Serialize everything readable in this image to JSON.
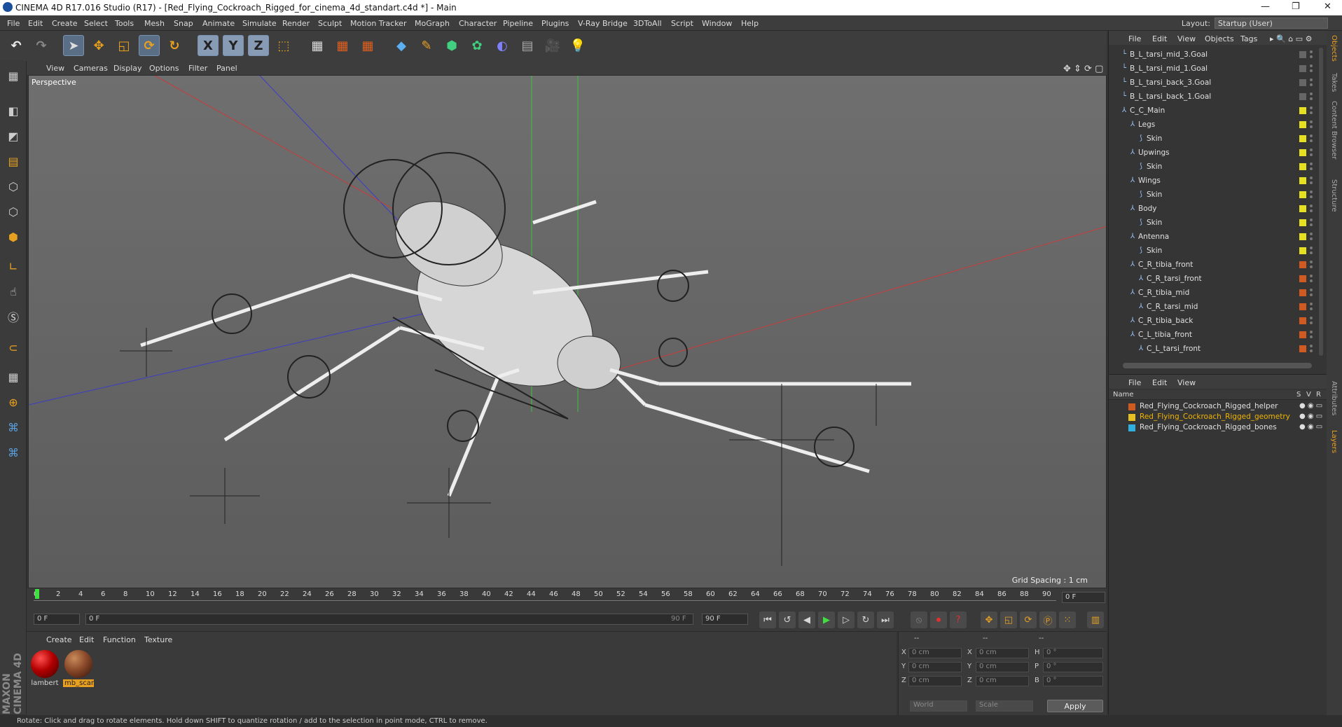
{
  "window": {
    "title": "CINEMA 4D R17.016 Studio (R17) - [Red_Flying_Cockroach_Rigged_for_cinema_4d_standart.c4d *] - Main"
  },
  "menu": [
    "File",
    "Edit",
    "Create",
    "Select",
    "Tools",
    "Mesh",
    "Snap",
    "Animate",
    "Simulate",
    "Render",
    "Sculpt",
    "Motion Tracker",
    "MoGraph",
    "Character",
    "Pipeline",
    "Plugins",
    "V-Ray Bridge",
    "3DToAll",
    "Script",
    "Window",
    "Help"
  ],
  "layout": {
    "label": "Layout:",
    "value": "Startup (User)"
  },
  "toolbar": {
    "undo": "↶",
    "redo": "↷",
    "x": "X",
    "y": "Y",
    "z": "Z"
  },
  "viewport": {
    "menu": [
      "View",
      "Cameras",
      "Display",
      "Options",
      "Filter",
      "Panel"
    ],
    "label": "Perspective",
    "grid": "Grid Spacing : 1 cm"
  },
  "timeline": {
    "ticks": [
      "0",
      "2",
      "4",
      "6",
      "8",
      "10",
      "12",
      "14",
      "16",
      "18",
      "20",
      "22",
      "24",
      "26",
      "28",
      "30",
      "32",
      "34",
      "36",
      "38",
      "40",
      "42",
      "44",
      "46",
      "48",
      "50",
      "52",
      "54",
      "56",
      "58",
      "60",
      "62",
      "64",
      "66",
      "68",
      "70",
      "72",
      "74",
      "76",
      "78",
      "80",
      "82",
      "84",
      "86",
      "88",
      "90"
    ],
    "end": "0 F"
  },
  "transport": {
    "start": "0 F",
    "current": "0 F",
    "end_inner": "90 F",
    "end": "90 F"
  },
  "materials": {
    "menu": [
      "Create",
      "Edit",
      "Function",
      "Texture"
    ],
    "items": [
      {
        "name": "lambert",
        "color": "#b30000"
      },
      {
        "name": "mb_scar",
        "color": "#8a4a2a"
      }
    ]
  },
  "coords": {
    "headers": [
      "--",
      "--",
      "--"
    ],
    "rows": [
      {
        "a": "X",
        "av": "0 cm",
        "b": "X",
        "bv": "0 cm",
        "c": "H",
        "cv": "0 °"
      },
      {
        "a": "Y",
        "av": "0 cm",
        "b": "Y",
        "bv": "0 cm",
        "c": "P",
        "cv": "0 °"
      },
      {
        "a": "Z",
        "av": "0 cm",
        "b": "Z",
        "bv": "0 cm",
        "c": "B",
        "cv": "0 °"
      }
    ],
    "world": "World",
    "scale": "Scale",
    "apply": "Apply"
  },
  "status": "Rotate: Click and drag to rotate elements. Hold down SHIFT to quantize rotation / add to the selection in point mode, CTRL to remove.",
  "objects": {
    "menu": [
      "File",
      "Edit",
      "View",
      "Objects",
      "Tags"
    ],
    "rows": [
      {
        "name": "B_L_tarsi_mid_3.Goal",
        "indent": 0,
        "tag": "#666"
      },
      {
        "name": "B_L_tarsi_mid_1.Goal",
        "indent": 0,
        "tag": "#666"
      },
      {
        "name": "B_L_tarsi_back_3.Goal",
        "indent": 0,
        "tag": "#666"
      },
      {
        "name": "B_L_tarsi_back_1.Goal",
        "indent": 0,
        "tag": "#666"
      },
      {
        "name": "C_C_Main",
        "indent": 0,
        "tag": "#e6e020"
      },
      {
        "name": "Legs",
        "indent": 1,
        "tag": "#e6e020"
      },
      {
        "name": "Skin",
        "indent": 2,
        "tag": "#e6e020"
      },
      {
        "name": "Upwings",
        "indent": 1,
        "tag": "#e6e020"
      },
      {
        "name": "Skin",
        "indent": 2,
        "tag": "#e6e020"
      },
      {
        "name": "Wings",
        "indent": 1,
        "tag": "#e6e020"
      },
      {
        "name": "Skin",
        "indent": 2,
        "tag": "#e6e020"
      },
      {
        "name": "Body",
        "indent": 1,
        "tag": "#e6e020"
      },
      {
        "name": "Skin",
        "indent": 2,
        "tag": "#e6e020"
      },
      {
        "name": "Antenna",
        "indent": 1,
        "tag": "#e6e020"
      },
      {
        "name": "Skin",
        "indent": 2,
        "tag": "#e6e020"
      },
      {
        "name": "C_R_tibia_front",
        "indent": 1,
        "tag": "#d05a20"
      },
      {
        "name": "C_R_tarsi_front",
        "indent": 2,
        "tag": "#d05a20"
      },
      {
        "name": "C_R_tibia_mid",
        "indent": 1,
        "tag": "#d05a20"
      },
      {
        "name": "C_R_tarsi_mid",
        "indent": 2,
        "tag": "#d05a20"
      },
      {
        "name": "C_R_tibia_back",
        "indent": 1,
        "tag": "#d05a20"
      },
      {
        "name": "C_L_tibia_front",
        "indent": 1,
        "tag": "#d05a20"
      },
      {
        "name": "C_L_tarsi_front",
        "indent": 2,
        "tag": "#d05a20"
      }
    ]
  },
  "layers": {
    "menu": [
      "File",
      "Edit",
      "View"
    ],
    "col_name": "Name",
    "cols": [
      "S",
      "V",
      "R"
    ],
    "rows": [
      {
        "name": "Red_Flying_Cockroach_Rigged_helper",
        "color": "#d05a20",
        "text": "#e0e0e0"
      },
      {
        "name": "Red_Flying_Cockroach_Rigged_geometry",
        "color": "#e6c020",
        "text": "#f0b400"
      },
      {
        "name": "Red_Flying_Cockroach_Rigged_bones",
        "color": "#30b0e0",
        "text": "#e0e0e0"
      }
    ]
  },
  "sidetabs": [
    "Objects",
    "Takes",
    "Content Browser",
    "Structure",
    "Attributes",
    "Layers"
  ],
  "brand": "MAXON CINEMA 4D"
}
